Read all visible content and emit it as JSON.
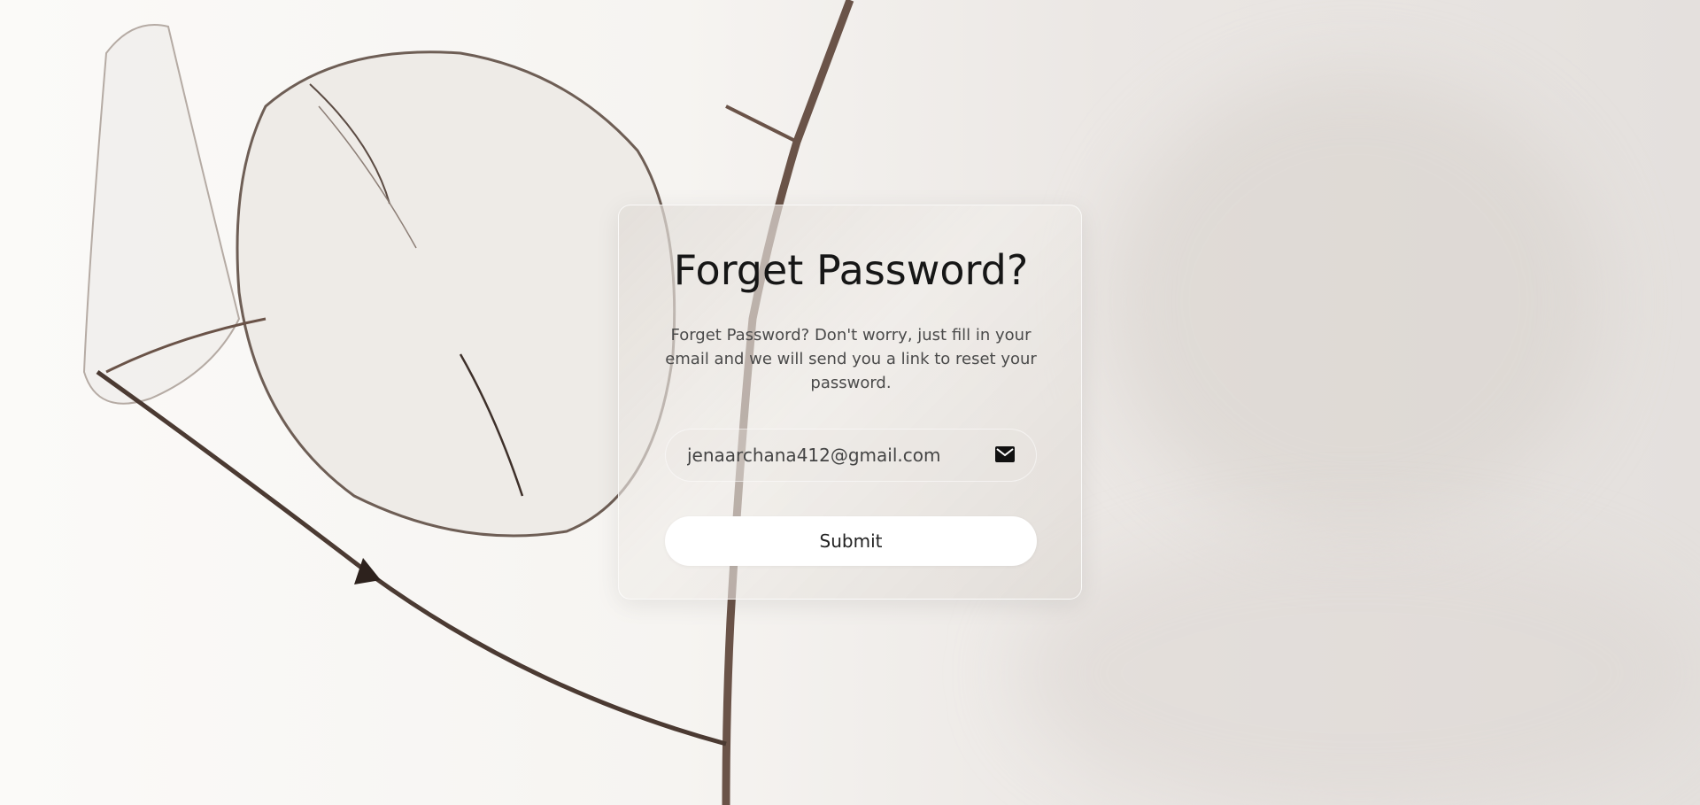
{
  "form": {
    "title": "Forget Password?",
    "description": "Forget Password? Don't worry, just fill in your email and we will send you a link to reset your password.",
    "email_value": "jenaarchana412@gmail.com",
    "email_icon": "mail-icon",
    "submit_label": "Submit"
  },
  "background": {
    "image": "dried-honesty-plant-photo",
    "colors": [
      "#fbfaf8",
      "#ebe7e4",
      "#d8d2cd",
      "#5a4a40"
    ]
  }
}
